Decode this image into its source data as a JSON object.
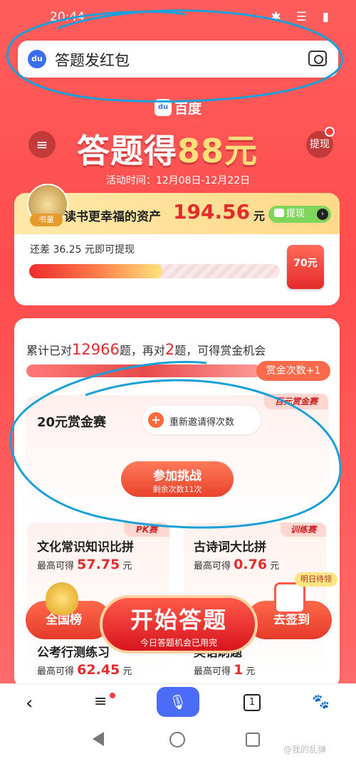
{
  "status_bar": {
    "time": "20:44"
  },
  "search": {
    "query": "答题发红包",
    "logo_text": "du"
  },
  "brand": {
    "logo_mark": "du",
    "name": "百度"
  },
  "header": {
    "menu_icon": "hamburger-icon",
    "withdraw": "提现"
  },
  "hero": {
    "title_prefix": "答题得",
    "amount": "88元",
    "period": "活动时间：12月08日-12月22日"
  },
  "assets": {
    "avatar_tag": "书童",
    "label": "读书更幸福的资产",
    "value": "194.56",
    "unit": "元",
    "withdraw_btn": "提现",
    "remaining": "还差 36.25 元即可提现",
    "progress_fraction": 0.53,
    "redpack_amount": "70元"
  },
  "quiz": {
    "correct_prefix": "累计已对",
    "correct_count": "12966",
    "correct_mid": "题，再对",
    "need_count": "2",
    "correct_suffix": "题，可得赏金机会",
    "bonus_pill": "赏金次数+1"
  },
  "contest": {
    "tag": "百元赏金赛",
    "title": "20元赏金赛",
    "invite": "重新邀请得次数",
    "join_label": "参加挑战",
    "join_sub": "剩余次数11次"
  },
  "mini_cards": [
    {
      "tag": "PK赛",
      "title": "文化常识知识比拼",
      "max_prefix": "最高可得",
      "max_value": "57.75",
      "max_unit": "元",
      "sub_title": "公考行测练习",
      "sub_prefix": "最高可得",
      "sub_value": "62.45",
      "sub_unit": "元"
    },
    {
      "tag": "训练赛",
      "title": "古诗词大比拼",
      "max_prefix": "最高可得",
      "max_value": "0.76",
      "max_unit": "元",
      "sub_title": "英语刷题",
      "sub_prefix": "最高可得",
      "sub_value": "1",
      "sub_unit": "元"
    }
  ],
  "dock": {
    "leaderboard": "全国榜",
    "start": "开始答题",
    "start_sub": "今日答题机会已用完",
    "checkin": "去签到",
    "daily_tag": "明日待领"
  },
  "navbar": {
    "tab_count": "1"
  },
  "watermark": "@我的乱弹",
  "colors": {
    "primary_red": "#ff4c4c",
    "accent_gold": "#ffe07a",
    "value_red": "#e52b2b",
    "annotation_blue": "#1aa0d8"
  }
}
